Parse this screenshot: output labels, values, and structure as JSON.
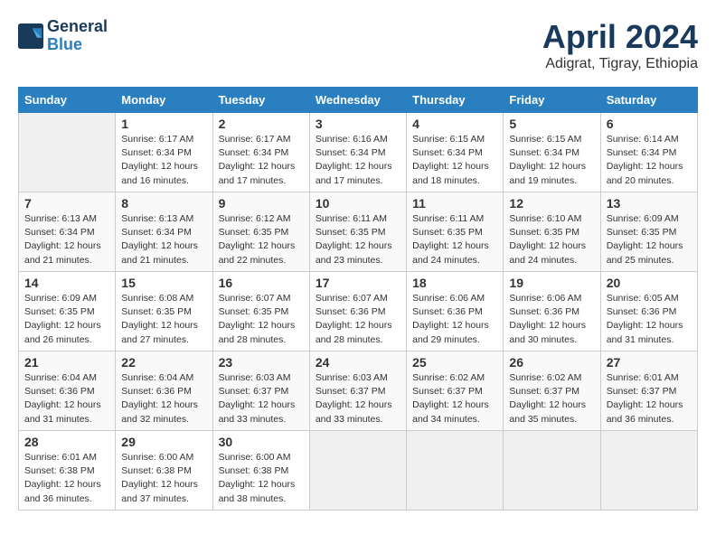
{
  "header": {
    "logo_line1": "General",
    "logo_line2": "Blue",
    "month": "April 2024",
    "location": "Adigrat, Tigray, Ethiopia"
  },
  "weekdays": [
    "Sunday",
    "Monday",
    "Tuesday",
    "Wednesday",
    "Thursday",
    "Friday",
    "Saturday"
  ],
  "weeks": [
    [
      {
        "day": "",
        "detail": ""
      },
      {
        "day": "1",
        "detail": "Sunrise: 6:17 AM\nSunset: 6:34 PM\nDaylight: 12 hours\nand 16 minutes."
      },
      {
        "day": "2",
        "detail": "Sunrise: 6:17 AM\nSunset: 6:34 PM\nDaylight: 12 hours\nand 17 minutes."
      },
      {
        "day": "3",
        "detail": "Sunrise: 6:16 AM\nSunset: 6:34 PM\nDaylight: 12 hours\nand 17 minutes."
      },
      {
        "day": "4",
        "detail": "Sunrise: 6:15 AM\nSunset: 6:34 PM\nDaylight: 12 hours\nand 18 minutes."
      },
      {
        "day": "5",
        "detail": "Sunrise: 6:15 AM\nSunset: 6:34 PM\nDaylight: 12 hours\nand 19 minutes."
      },
      {
        "day": "6",
        "detail": "Sunrise: 6:14 AM\nSunset: 6:34 PM\nDaylight: 12 hours\nand 20 minutes."
      }
    ],
    [
      {
        "day": "7",
        "detail": "Sunrise: 6:13 AM\nSunset: 6:34 PM\nDaylight: 12 hours\nand 21 minutes."
      },
      {
        "day": "8",
        "detail": "Sunrise: 6:13 AM\nSunset: 6:34 PM\nDaylight: 12 hours\nand 21 minutes."
      },
      {
        "day": "9",
        "detail": "Sunrise: 6:12 AM\nSunset: 6:35 PM\nDaylight: 12 hours\nand 22 minutes."
      },
      {
        "day": "10",
        "detail": "Sunrise: 6:11 AM\nSunset: 6:35 PM\nDaylight: 12 hours\nand 23 minutes."
      },
      {
        "day": "11",
        "detail": "Sunrise: 6:11 AM\nSunset: 6:35 PM\nDaylight: 12 hours\nand 24 minutes."
      },
      {
        "day": "12",
        "detail": "Sunrise: 6:10 AM\nSunset: 6:35 PM\nDaylight: 12 hours\nand 24 minutes."
      },
      {
        "day": "13",
        "detail": "Sunrise: 6:09 AM\nSunset: 6:35 PM\nDaylight: 12 hours\nand 25 minutes."
      }
    ],
    [
      {
        "day": "14",
        "detail": "Sunrise: 6:09 AM\nSunset: 6:35 PM\nDaylight: 12 hours\nand 26 minutes."
      },
      {
        "day": "15",
        "detail": "Sunrise: 6:08 AM\nSunset: 6:35 PM\nDaylight: 12 hours\nand 27 minutes."
      },
      {
        "day": "16",
        "detail": "Sunrise: 6:07 AM\nSunset: 6:35 PM\nDaylight: 12 hours\nand 28 minutes."
      },
      {
        "day": "17",
        "detail": "Sunrise: 6:07 AM\nSunset: 6:36 PM\nDaylight: 12 hours\nand 28 minutes."
      },
      {
        "day": "18",
        "detail": "Sunrise: 6:06 AM\nSunset: 6:36 PM\nDaylight: 12 hours\nand 29 minutes."
      },
      {
        "day": "19",
        "detail": "Sunrise: 6:06 AM\nSunset: 6:36 PM\nDaylight: 12 hours\nand 30 minutes."
      },
      {
        "day": "20",
        "detail": "Sunrise: 6:05 AM\nSunset: 6:36 PM\nDaylight: 12 hours\nand 31 minutes."
      }
    ],
    [
      {
        "day": "21",
        "detail": "Sunrise: 6:04 AM\nSunset: 6:36 PM\nDaylight: 12 hours\nand 31 minutes."
      },
      {
        "day": "22",
        "detail": "Sunrise: 6:04 AM\nSunset: 6:36 PM\nDaylight: 12 hours\nand 32 minutes."
      },
      {
        "day": "23",
        "detail": "Sunrise: 6:03 AM\nSunset: 6:37 PM\nDaylight: 12 hours\nand 33 minutes."
      },
      {
        "day": "24",
        "detail": "Sunrise: 6:03 AM\nSunset: 6:37 PM\nDaylight: 12 hours\nand 33 minutes."
      },
      {
        "day": "25",
        "detail": "Sunrise: 6:02 AM\nSunset: 6:37 PM\nDaylight: 12 hours\nand 34 minutes."
      },
      {
        "day": "26",
        "detail": "Sunrise: 6:02 AM\nSunset: 6:37 PM\nDaylight: 12 hours\nand 35 minutes."
      },
      {
        "day": "27",
        "detail": "Sunrise: 6:01 AM\nSunset: 6:37 PM\nDaylight: 12 hours\nand 36 minutes."
      }
    ],
    [
      {
        "day": "28",
        "detail": "Sunrise: 6:01 AM\nSunset: 6:38 PM\nDaylight: 12 hours\nand 36 minutes."
      },
      {
        "day": "29",
        "detail": "Sunrise: 6:00 AM\nSunset: 6:38 PM\nDaylight: 12 hours\nand 37 minutes."
      },
      {
        "day": "30",
        "detail": "Sunrise: 6:00 AM\nSunset: 6:38 PM\nDaylight: 12 hours\nand 38 minutes."
      },
      {
        "day": "",
        "detail": ""
      },
      {
        "day": "",
        "detail": ""
      },
      {
        "day": "",
        "detail": ""
      },
      {
        "day": "",
        "detail": ""
      }
    ]
  ]
}
